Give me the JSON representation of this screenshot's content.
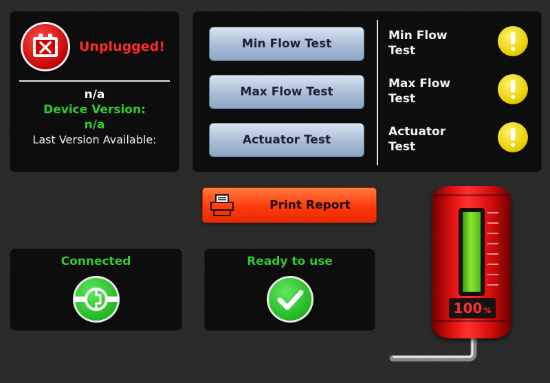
{
  "device": {
    "status": "Unplugged!",
    "firmware_value": "n/a",
    "device_version_label": "Device Version:",
    "device_version_value": "n/a",
    "last_version_label": "Last Version Available:"
  },
  "tests": [
    {
      "button_label": "Min Flow Test",
      "status_label": "Min Flow Test",
      "status_icon": "warning-icon"
    },
    {
      "button_label": "Max Flow Test",
      "status_label": "Max Flow Test",
      "status_icon": "warning-icon"
    },
    {
      "button_label": "Actuator Test",
      "status_label": "Actuator Test",
      "status_icon": "warning-icon"
    }
  ],
  "print_button": {
    "label": "Print Report",
    "icon": "printer-icon"
  },
  "connection": {
    "label": "Connected",
    "icon": "plug-icon"
  },
  "readiness": {
    "label": "Ready to use",
    "icon": "checkmark-icon"
  },
  "level_gauge": {
    "value": 100,
    "unit": "%",
    "fill_fraction": 1.0
  },
  "colors": {
    "error": "#ff2a2a",
    "ok": "#2fcc2f",
    "warning": "#e6cf00",
    "print_button": "#ff3a0a",
    "test_button": "#a9bcd6",
    "gauge_body": "#e01010"
  }
}
